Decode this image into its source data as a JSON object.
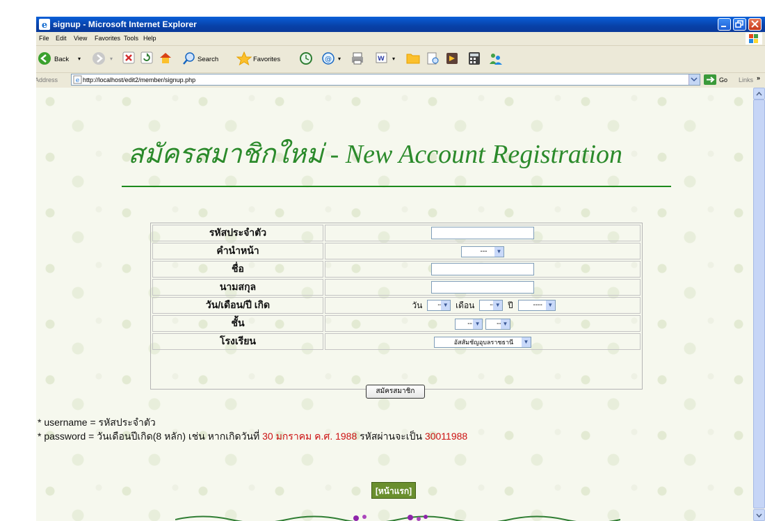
{
  "window": {
    "title": "signup - Microsoft Internet Explorer"
  },
  "menu": [
    "File",
    "Edit",
    "View",
    "Favorites",
    "Tools",
    "Help"
  ],
  "toolbar": {
    "back": "Back",
    "search": "Search",
    "favorites": "Favorites"
  },
  "address": {
    "label": "Address",
    "url": "http://localhost/edit2/member/signup.php",
    "go": "Go",
    "links": "Links"
  },
  "page": {
    "heading": "สมัครสมาชิกใหม่ - New Account Registration",
    "form": {
      "id_label": "รหัสประจำตัว",
      "prefix_label": "คำนำหน้า",
      "prefix_value": "---",
      "first_name_label": "ชื่อ",
      "last_name_label": "นามสกุล",
      "birthdate_label": "วัน/เดือน/ปี เกิด",
      "day_label": "วัน",
      "day_value": "--",
      "month_label": "เดือน",
      "month_value": "--",
      "year_label": "ปี",
      "year_value": "----",
      "class_label": "ชั้น",
      "class_value_1": "--",
      "class_value_2": "--",
      "school_label": "โรงเรียน",
      "school_value": "อัสสัมชัญอุบลราชธานี"
    },
    "submit_label": "สมัครสมาชิก",
    "note1": "* username = รหัสประจำตัว",
    "note2_prefix": "* password = วันเดือนปีเกิด(8 หลัก) เช่น หากเกิดวันที่ ",
    "note2_date": "30 มกราคม ค.ศ. 1988",
    "note2_mid": " รหัสผ่านจะเป็น ",
    "note2_password": "30011988",
    "home_link": "[หน้าแรก]"
  },
  "colors": {
    "heading": "#2b8a2b",
    "highlight": "#cc1111",
    "titlebar": "#0a5fd8"
  }
}
